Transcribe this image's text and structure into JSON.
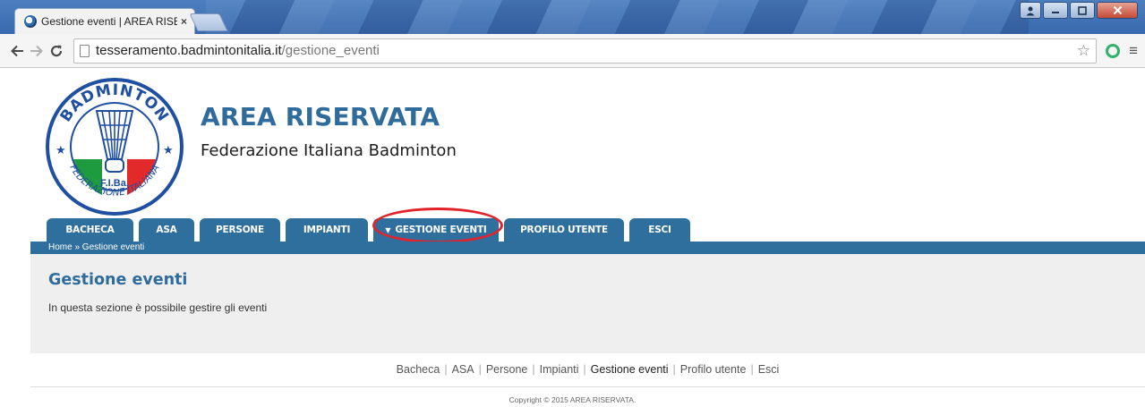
{
  "browser": {
    "tab_title": "Gestione eventi | AREA RISERVATA",
    "tab_close": "×",
    "url_host": "tesseramento.badmintonitalia.it",
    "url_path": "/gestione_eventi",
    "back_icon": "arrow-left-icon",
    "forward_icon": "arrow-right-icon",
    "reload_icon": "reload-icon",
    "bookmark_icon": "star-icon",
    "menu_icon": "hamburger-menu-icon"
  },
  "site": {
    "title": "AREA RISERVATA",
    "subtitle": "Federazione Italiana Badminton",
    "logo": {
      "top_text": "BADMINTON",
      "bottom_text": "FEDERAZIONE ITALIANA",
      "abbr": "F.I.Ba.",
      "colors": {
        "green": "#1e9b3e",
        "white": "#ffffff",
        "red": "#e22a2a",
        "blue": "#1f4fa0"
      }
    }
  },
  "nav": {
    "tabs": [
      {
        "label": "BACHECA",
        "active": false
      },
      {
        "label": "ASA",
        "active": false
      },
      {
        "label": "PERSONE",
        "active": false
      },
      {
        "label": "IMPIANTI",
        "active": false
      },
      {
        "label": "GESTIONE EVENTI",
        "active": true,
        "has_caret": true
      },
      {
        "label": "PROFILO UTENTE",
        "active": false
      },
      {
        "label": "ESCI",
        "active": false
      }
    ],
    "caret": "▼"
  },
  "breadcrumb": "Home » Gestione eventi",
  "content": {
    "heading": "Gestione eventi",
    "text": "In questa sezione è possibile gestire gli eventi"
  },
  "footer": {
    "links": [
      "Bacheca",
      "ASA",
      "Persone",
      "Impianti",
      "Gestione eventi",
      "Profilo utente",
      "Esci"
    ],
    "copyright": "Copyright © 2015 AREA RISERVATA."
  },
  "colors": {
    "brand_blue": "#2f6f9e",
    "highlight_red": "#e2232a",
    "content_bg": "#efefef"
  }
}
